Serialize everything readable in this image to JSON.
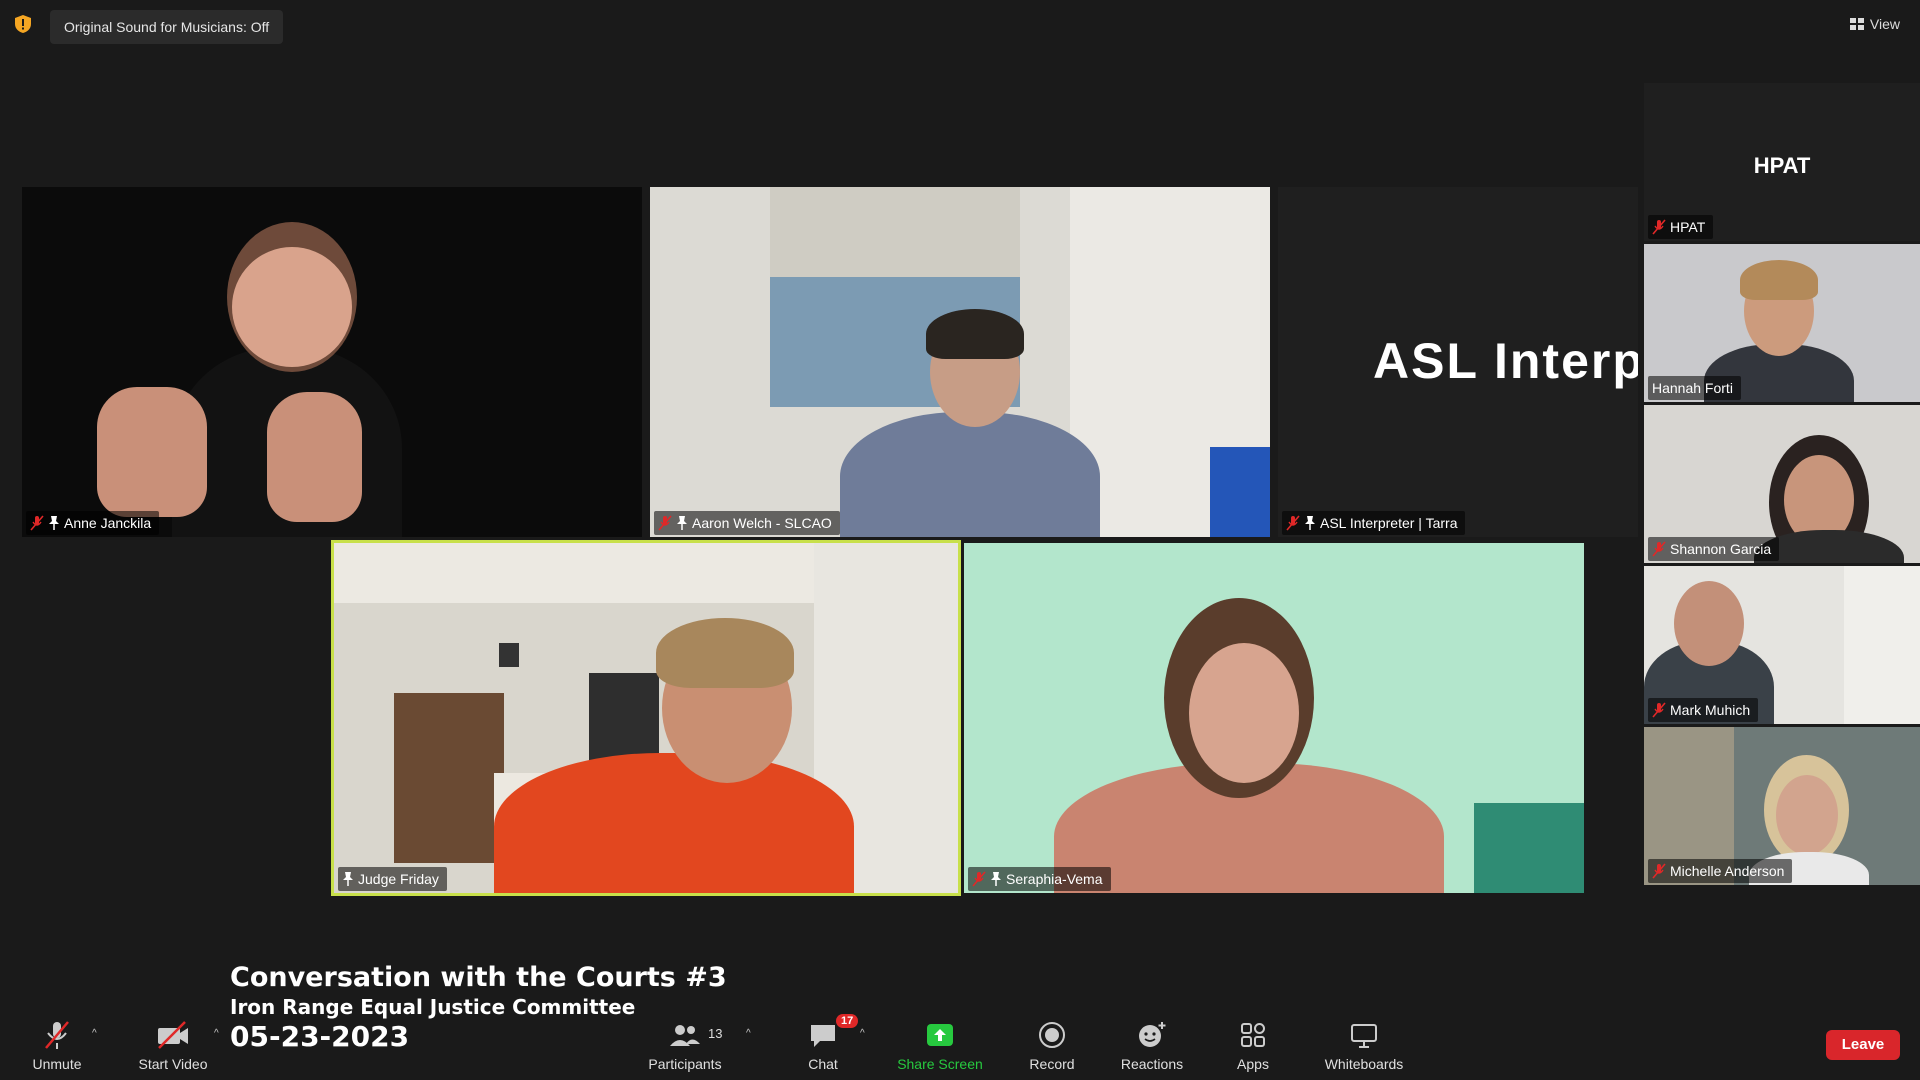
{
  "window": {
    "sound_toggle_label": "Original Sound for Musicians: Off",
    "view_label": "View"
  },
  "main_grid": {
    "tiles": [
      {
        "name": "Anne Janckila",
        "muted": true,
        "pinned": true
      },
      {
        "name": "Aaron Welch - SLCAO",
        "muted": true,
        "pinned": true
      },
      {
        "name": "ASL Interpreter | Tarra",
        "muted": true,
        "pinned": true,
        "label_text": "ASL  Interp"
      },
      {
        "name": "Judge Friday",
        "muted": false,
        "pinned": true,
        "active_speaker": true
      },
      {
        "name": "Seraphia-Vema",
        "muted": true,
        "pinned": true
      }
    ]
  },
  "side_strip": {
    "tiles": [
      {
        "name": "HPAT",
        "title": "HPAT",
        "muted": true
      },
      {
        "name": "Hannah Forti",
        "muted": false
      },
      {
        "name": "Shannon Garcia",
        "muted": true
      },
      {
        "name": "Mark Muhich",
        "muted": true
      },
      {
        "name": "Michelle Anderson",
        "muted": true
      }
    ]
  },
  "caption": {
    "line1": "Conversation with the Courts #3",
    "line2": "Iron Range Equal Justice Committee",
    "line3": "05-23-2023"
  },
  "toolbar": {
    "unmute": "Unmute",
    "start_video": "Start Video",
    "participants": "Participants",
    "participants_count": "13",
    "chat": "Chat",
    "chat_badge": "17",
    "share_screen": "Share Screen",
    "record": "Record",
    "reactions": "Reactions",
    "apps": "Apps",
    "whiteboards": "Whiteboards",
    "leave": "Leave"
  },
  "colors": {
    "background": "#1a1a1a",
    "active_speaker_border": "#c8e04a",
    "share_green": "#27c93f",
    "leave_red": "#d9262b",
    "mute_red": "#e02828"
  }
}
